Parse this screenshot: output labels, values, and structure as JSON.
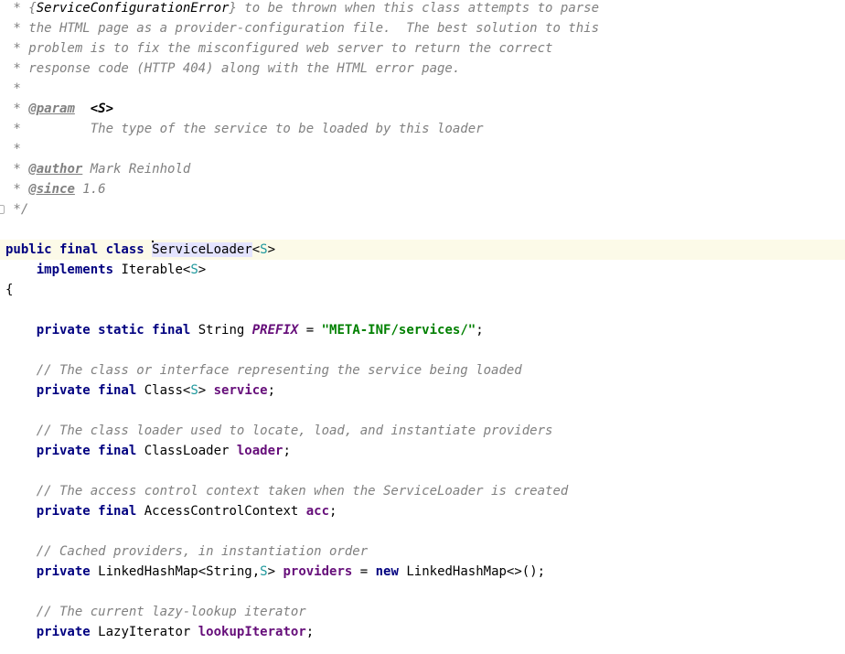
{
  "editor": {
    "lines": {
      "l1": {
        "star": " * ",
        "brace_open": "{",
        "ref": "ServiceConfigurationError",
        "rest": "} to be thrown when this class attempts to parse"
      },
      "l2": {
        "text": " * the HTML page as a provider-configuration file.  The best solution to this"
      },
      "l3": {
        "text": " * problem is to fix the misconfigured web server to return the correct"
      },
      "l4": {
        "text": " * response code (HTTP 404) along with the HTML error page."
      },
      "l5": {
        "text": " *"
      },
      "l6": {
        "star": " * ",
        "tag": "@param",
        "gap": "  ",
        "type_param": "<S>"
      },
      "l7": {
        "text": " *         The type of the service to be loaded by this loader"
      },
      "l8": {
        "text": " *"
      },
      "l9": {
        "star": " * ",
        "tag": "@author",
        "rest": " Mark Reinhold"
      },
      "l10": {
        "star": " * ",
        "tag": "@since",
        "rest": " 1.6"
      },
      "l11": {
        "text": " */"
      },
      "l13": {
        "kw": "public final class",
        "sp": " ",
        "class_name": "ServiceLoader",
        "lt": "<",
        "tvar": "S",
        "gt": ">"
      },
      "l14": {
        "indent": "    ",
        "kw": "implements",
        "type": " Iterable<",
        "tvar": "S",
        "gt": ">"
      },
      "l15": {
        "text": "{"
      },
      "l17": {
        "indent": "    ",
        "kw": "private static final",
        "type": " String ",
        "name": "PREFIX",
        "eq": " = ",
        "value": "\"META-INF/services/\"",
        "semi": ";"
      },
      "l19": {
        "text": "    // The class or interface representing the service being loaded"
      },
      "l20": {
        "indent": "    ",
        "kw": "private final",
        "type": " Class<",
        "tvar": "S",
        "gt": "> ",
        "name": "service",
        "semi": ";"
      },
      "l22": {
        "text": "    // The class loader used to locate, load, and instantiate providers"
      },
      "l23": {
        "indent": "    ",
        "kw": "private final",
        "type": " ClassLoader ",
        "name": "loader",
        "semi": ";"
      },
      "l25": {
        "text": "    // The access control context taken when the ServiceLoader is created"
      },
      "l26": {
        "indent": "    ",
        "kw": "private final",
        "type": " AccessControlContext ",
        "name": "acc",
        "semi": ";"
      },
      "l28": {
        "text": "    // Cached providers, in instantiation order"
      },
      "l29": {
        "indent": "    ",
        "kw": "private",
        "type": " LinkedHashMap<String,",
        "tvar": "S",
        "gt": "> ",
        "name": "providers",
        "eq": " = ",
        "kw_new": "new",
        "rest": " LinkedHashMap<>();"
      },
      "l31": {
        "text": "    // The current lazy-lookup iterator"
      },
      "l32": {
        "indent": "    ",
        "kw": "private",
        "type": " LazyIterator ",
        "name": "lookupIterator",
        "semi": ";"
      }
    }
  },
  "colors": {
    "keyword": "#000080",
    "comment": "#808080",
    "field": "#660e7a",
    "string": "#008000",
    "type_parameter": "#20999d",
    "caret_line": "#fcfae8",
    "identifier_highlight": "#e4e4ff"
  }
}
